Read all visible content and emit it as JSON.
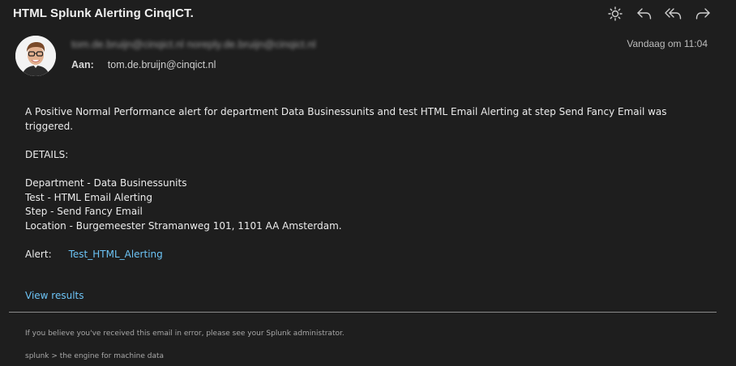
{
  "email": {
    "subject": "HTML Splunk Alerting CinqICT.",
    "from_redacted": "tom.de.bruijn@cinqict.nl  noreply.de.bruijn@cinqict.nl",
    "date": "Vandaag om 11:04",
    "to_label": "Aan:",
    "to_value": "tom.de.bruijn@cinqict.nl"
  },
  "toolbar": {
    "icons": [
      "sun-icon",
      "reply-icon",
      "reply-all-icon",
      "forward-icon"
    ]
  },
  "body": {
    "intro": "A Positive Normal Performance alert for department Data Businessunits and test HTML Email Alerting at step Send Fancy Email was triggered.",
    "details_heading": "DETAILS:",
    "department": "Department - Data Businessunits",
    "test": "Test - HTML Email Alerting",
    "step": "Step - Send Fancy Email",
    "location": "Location - Burgemeester Stramanweg 101, 1101 AA Amsterdam.",
    "alert_label": "Alert:",
    "alert_link": "Test_HTML_Alerting",
    "view_results": "View results"
  },
  "footer": {
    "note": "If you believe you've received this email in error, please see your Splunk administrator.",
    "tagline": "splunk > the engine for machine data"
  },
  "colors": {
    "background": "#1e1e1e",
    "link": "#6cc3f5",
    "text": "#ececec"
  }
}
